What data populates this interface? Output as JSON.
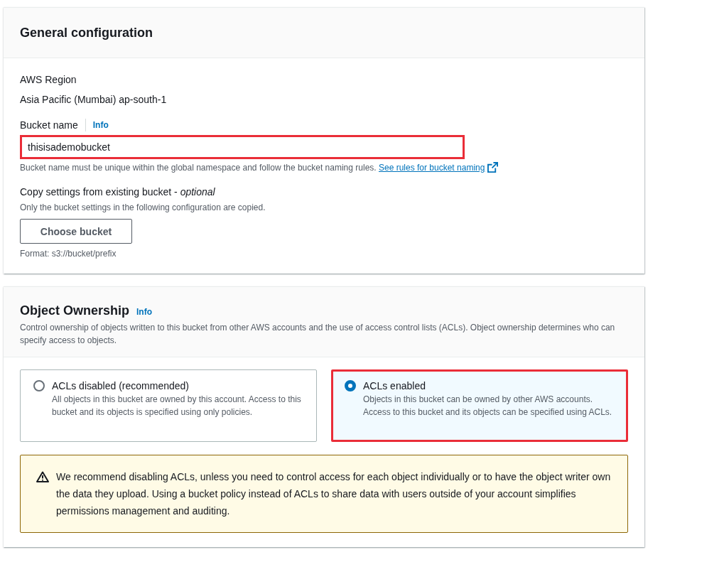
{
  "general": {
    "title": "General configuration",
    "region": {
      "label": "AWS Region",
      "value": "Asia Pacific (Mumbai) ap-south-1"
    },
    "bucket_name": {
      "label": "Bucket name",
      "info": "Info",
      "value": "thisisademobucket",
      "highlighted": true,
      "hint": "Bucket name must be unique within the global namespace and follow the bucket naming rules.",
      "link": "See rules for bucket naming"
    },
    "copy": {
      "label": "Copy settings from existing bucket - *optional*",
      "description": "Only the bucket settings in the following configuration are copied.",
      "button": "Choose bucket",
      "format": "Format: s3://bucket/prefix"
    }
  },
  "ownership": {
    "title": "Object Ownership",
    "info": "Info",
    "description": "Control ownership of objects written to this bucket from other AWS accounts and the use of access control lists (ACLs). Object ownership determines who can specify access to objects.",
    "options": [
      {
        "label": "ACLs disabled (recommended)",
        "description": "All objects in this bucket are owned by this account. Access to this bucket and its objects is specified using only policies.",
        "selected": false,
        "highlighted": false
      },
      {
        "label": "ACLs enabled",
        "description": "Objects in this bucket can be owned by other AWS accounts. Access to this bucket and its objects can be specified using ACLs.",
        "selected": true,
        "highlighted": true
      }
    ],
    "warning": "We recommend disabling ACLs, unless you need to control access for each object individually or to have the object writer own the data they upload. Using a bucket policy instead of ACLs to share data with users outside of your account simplifies permissions management and auditing."
  }
}
